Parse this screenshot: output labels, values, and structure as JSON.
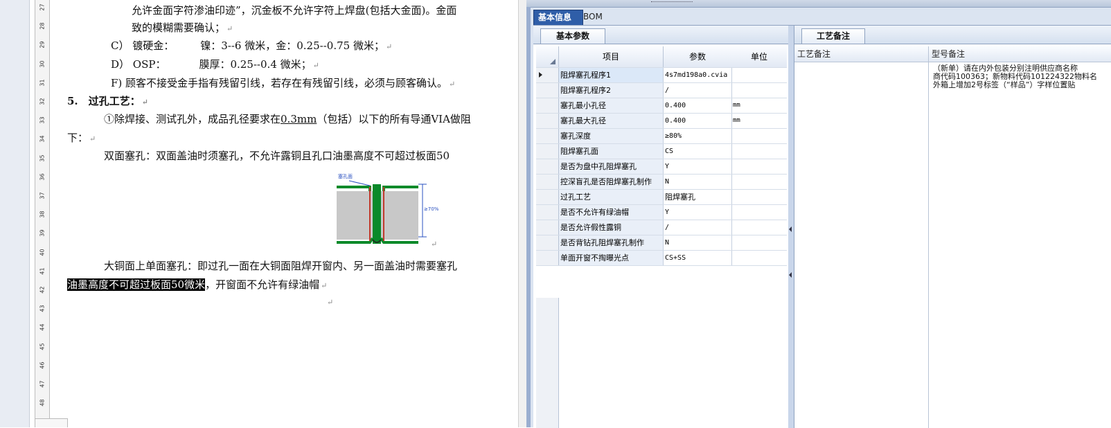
{
  "document": {
    "ruler_numbers": [
      "27",
      "28",
      "29",
      "30",
      "31",
      "32",
      "33",
      "34",
      "35",
      "36",
      "37",
      "38",
      "39",
      "40",
      "41",
      "42",
      "43",
      "44",
      "45",
      "46",
      "47",
      "48"
    ],
    "line1": "允许金面字符渗油印迹”，沉金板不允许字符上焊盘(包括大金面)。金面",
    "line2": "致的模糊需要确认；",
    "line3_label": "C） 镀硬金：",
    "line3_value": "镍：3--6 微米，金：0.25--0.75 微米；",
    "line4_label": "D） OSP：",
    "line4_value": "膜厚：0.25--0.4 微米；",
    "line5": "F) 顾客不接受金手指有残留引线，若存在有残留引线，必须与顾客确认。",
    "heading": "5.　过孔工艺：",
    "line7_pre": "①除焊接、测试孔外，成品孔径要求在",
    "line7_ul": "0.3mm",
    "line7_post": "（包括）以下的所有导通VIA做阻",
    "line8": "下：",
    "line9": "双面塞孔：双面盖油时须塞孔，不允许露铜且孔口油墨高度不可超过板面50",
    "figure_label": "塞孔面",
    "figure_dim": "≥70%",
    "line11": "大铜面上单面塞孔：即过孔一面在大铜面阻焊开窗内、另一面盖油时需要塞孔",
    "line12_hl": "油墨高度不可超过板面50微米",
    "line12_post": "，开窗面不允许有绿油帽",
    "para_mark": "↵"
  },
  "app": {
    "tabs": [
      "基本信息",
      "BOM"
    ],
    "left_panel_title": "基本参数",
    "right_panel_title": "工艺备注",
    "grid": {
      "headers": [
        "项目",
        "参数",
        "单位"
      ],
      "rows": [
        {
          "item": "阻焊塞孔程序1",
          "param": "4s7md198a0.cvia",
          "unit": ""
        },
        {
          "item": "阻焊塞孔程序2",
          "param": "/",
          "unit": ""
        },
        {
          "item": "塞孔最小孔径",
          "param": "0.400",
          "unit": "mm"
        },
        {
          "item": "塞孔最大孔径",
          "param": "0.400",
          "unit": "mm"
        },
        {
          "item": "塞孔深度",
          "param": "≥80%",
          "unit": ""
        },
        {
          "item": "阻焊塞孔面",
          "param": "CS",
          "unit": ""
        },
        {
          "item": "是否为盘中孔阻焊塞孔",
          "param": "Y",
          "unit": ""
        },
        {
          "item": "控深盲孔是否阻焊塞孔制作",
          "param": "N",
          "unit": ""
        },
        {
          "item": "过孔工艺",
          "param": "阻焊塞孔",
          "unit": ""
        },
        {
          "item": "是否不允许有绿油帽",
          "param": "Y",
          "unit": ""
        },
        {
          "item": "是否允许假性露铜",
          "param": "/",
          "unit": ""
        },
        {
          "item": "是否背钻孔阻焊塞孔制作",
          "param": "N",
          "unit": ""
        },
        {
          "item": "单面开窗不掏曝光点",
          "param": "CS+SS",
          "unit": ""
        }
      ]
    },
    "notes": {
      "col1_header": "工艺备注",
      "col2_header": "型号备注",
      "model_note_lines": [
        "（新单）请在内外包装分别注明供应商名称",
        "商代码100363；新物料代码101224322物料名",
        "外箱上增加2号标签（“样品”）字样位置贴"
      ]
    }
  }
}
